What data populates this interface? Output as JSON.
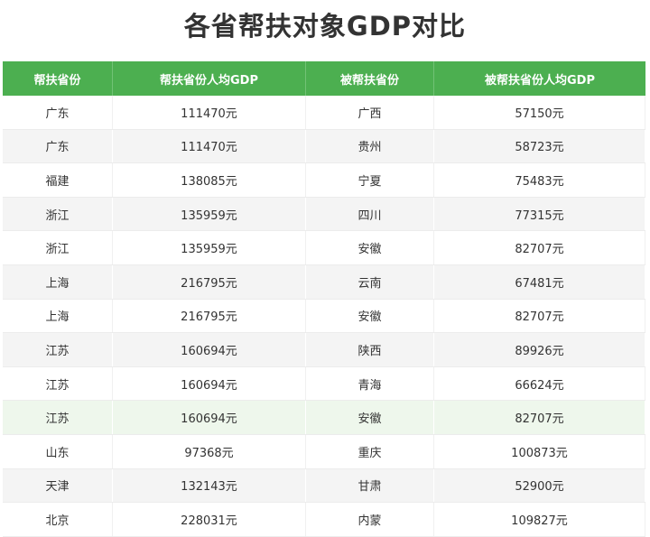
{
  "title": "各省帮扶对象GDP对比",
  "table": {
    "headers": [
      "帮扶省份",
      "帮扶省份人均GDP",
      "被帮扶省份",
      "被帮扶省份人均GDP"
    ],
    "rows": [
      [
        "广东",
        "111470元",
        "广西",
        "57150元"
      ],
      [
        "广东",
        "111470元",
        "贵州",
        "58723元"
      ],
      [
        "福建",
        "138085元",
        "宁夏",
        "75483元"
      ],
      [
        "浙江",
        "135959元",
        "四川",
        "77315元"
      ],
      [
        "浙江",
        "135959元",
        "安徽",
        "82707元"
      ],
      [
        "上海",
        "216795元",
        "云南",
        "67481元"
      ],
      [
        "上海",
        "216795元",
        "安徽",
        "82707元"
      ],
      [
        "江苏",
        "160694元",
        "陕西",
        "89926元"
      ],
      [
        "江苏",
        "160694元",
        "青海",
        "66624元"
      ],
      [
        "江苏",
        "160694元",
        "安徽",
        "82707元"
      ],
      [
        "山东",
        "97368元",
        "重庆",
        "100873元"
      ],
      [
        "天津",
        "132143元",
        "甘肃",
        "52900元"
      ],
      [
        "北京",
        "228031元",
        "内蒙",
        "109827元"
      ]
    ]
  },
  "colors": {
    "header_bg": "#4caf50",
    "header_text": "#ffffff",
    "stripe": "#f4f4f4",
    "highlight_row": "#eef7ec"
  }
}
